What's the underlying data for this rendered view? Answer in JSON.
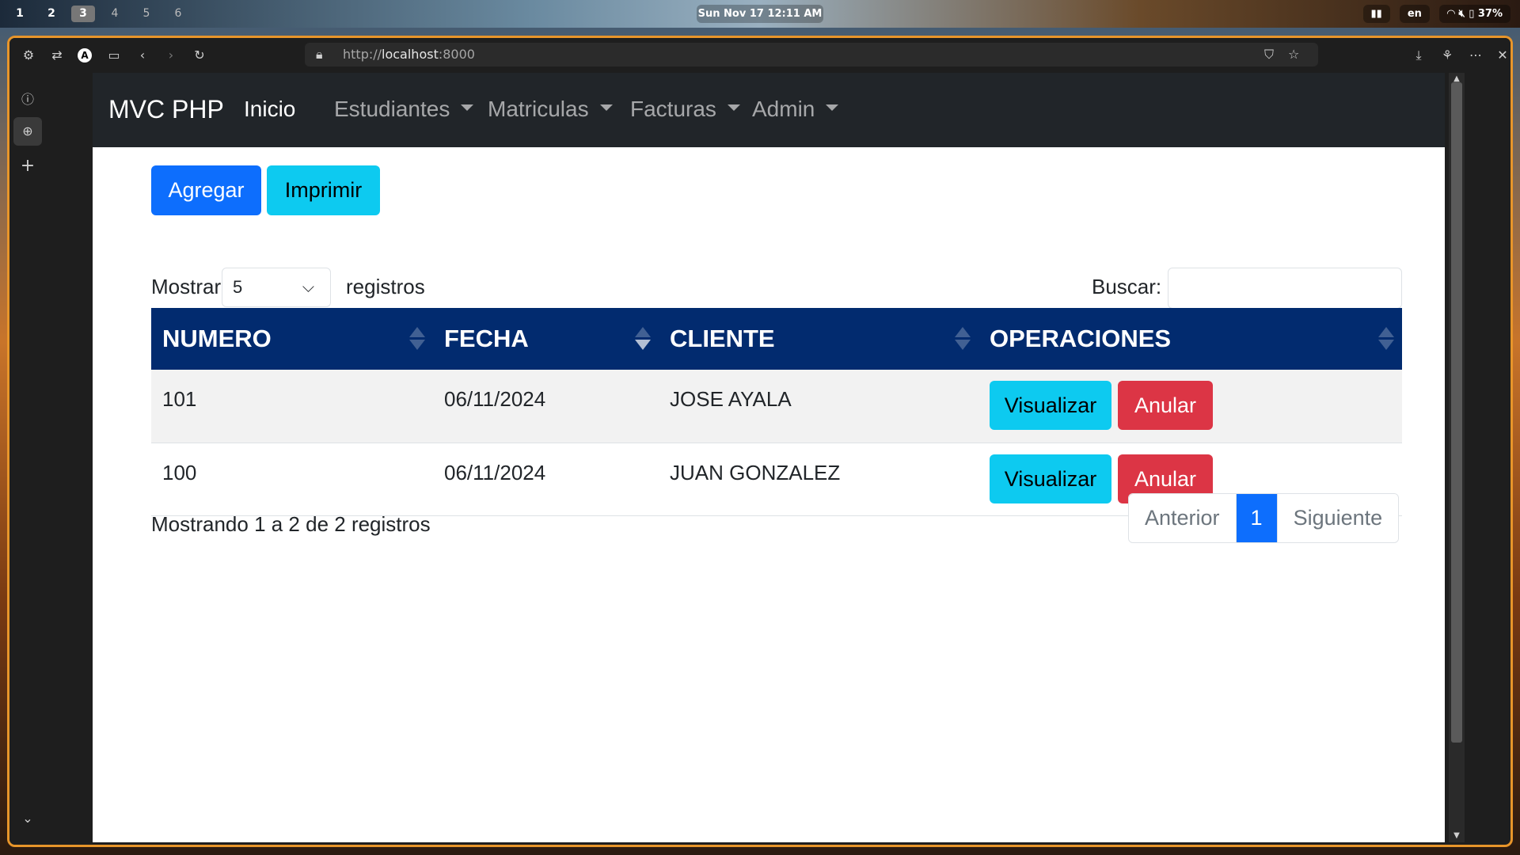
{
  "desktop": {
    "workspaces": [
      "1",
      "2",
      "3",
      "4",
      "5",
      "6"
    ],
    "active_workspace": "3",
    "clock": "Sun Nov 17  12:11 AM",
    "language": "en",
    "battery": "37%"
  },
  "browser": {
    "url_prefix": "http://",
    "url_host": "localhost",
    "url_port": ":8000"
  },
  "navbar": {
    "brand": "MVC PHP",
    "items": [
      {
        "label": "Inicio",
        "dropdown": false
      },
      {
        "label": "Estudiantes",
        "dropdown": true
      },
      {
        "label": "Matriculas",
        "dropdown": true
      },
      {
        "label": "Facturas",
        "dropdown": true
      },
      {
        "label": "Admin",
        "dropdown": true
      }
    ]
  },
  "toolbar": {
    "add_label": "Agregar",
    "print_label": "Imprimir"
  },
  "controls": {
    "show_label": "Mostrar",
    "page_size": "5",
    "records_label": "registros",
    "search_label": "Buscar:",
    "search_value": ""
  },
  "table": {
    "headers": [
      "NUMERO",
      "FECHA",
      "CLIENTE",
      "OPERACIONES"
    ],
    "rows": [
      {
        "numero": "101",
        "fecha": "06/11/2024",
        "cliente": "JOSE AYALA"
      },
      {
        "numero": "100",
        "fecha": "06/11/2024",
        "cliente": "JUAN GONZALEZ"
      }
    ],
    "view_label": "Visualizar",
    "cancel_label": "Anular"
  },
  "footer": {
    "info": "Mostrando 1 a 2 de 2 registros",
    "prev_label": "Anterior",
    "current_page": "1",
    "next_label": "Siguiente"
  },
  "colors": {
    "primary": "#0d6efd",
    "info": "#0dcaf0",
    "danger": "#dc3545",
    "table_header": "#022b6f",
    "navbar": "#212529",
    "window_border": "#e8952a"
  }
}
